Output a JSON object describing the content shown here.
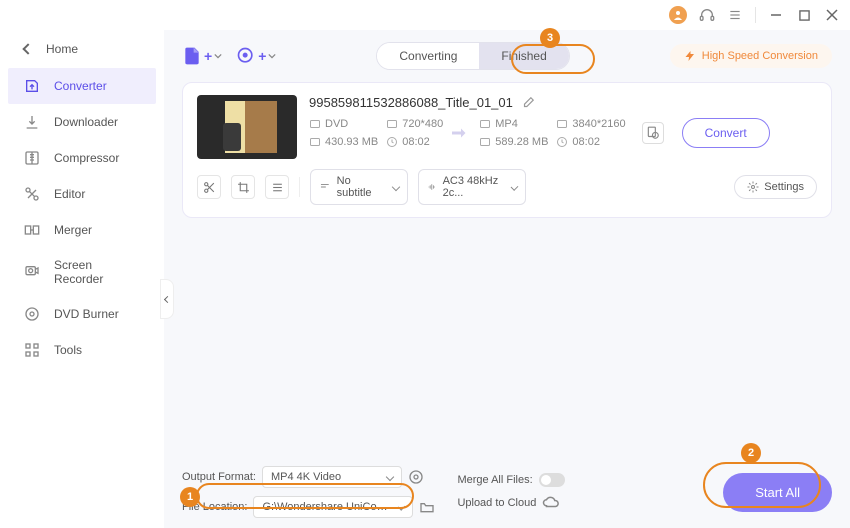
{
  "titlebar": {
    "minimize_tip": "Minimize",
    "maximize_tip": "Maximize",
    "close_tip": "Close"
  },
  "sidebar": {
    "home": "Home",
    "items": [
      {
        "label": "Converter"
      },
      {
        "label": "Downloader"
      },
      {
        "label": "Compressor"
      },
      {
        "label": "Editor"
      },
      {
        "label": "Merger"
      },
      {
        "label": "Screen Recorder"
      },
      {
        "label": "DVD Burner"
      },
      {
        "label": "Tools"
      }
    ]
  },
  "tabs": {
    "converting": "Converting",
    "finished": "Finished"
  },
  "highspeed_label": "High Speed Conversion",
  "file": {
    "title": "995859811532886088_Title_01_01",
    "src_format": "DVD",
    "src_res": "720*480",
    "src_size": "430.93 MB",
    "src_dur": "08:02",
    "dst_format": "MP4",
    "dst_res": "3840*2160",
    "dst_size": "589.28 MB",
    "dst_dur": "08:02",
    "subtitle_label": "No subtitle",
    "audio_label": "AC3 48kHz 2c...",
    "settings_label": "Settings",
    "convert_label": "Convert"
  },
  "footer": {
    "output_format_label": "Output Format:",
    "output_format_value": "MP4 4K Video",
    "file_location_label": "File Location:",
    "file_location_value": "G:\\Wondershare UniConverter",
    "merge_label": "Merge All Files:",
    "upload_label": "Upload to Cloud",
    "start_all": "Start All"
  },
  "callouts": {
    "c1": "1",
    "c2": "2",
    "c3": "3"
  }
}
